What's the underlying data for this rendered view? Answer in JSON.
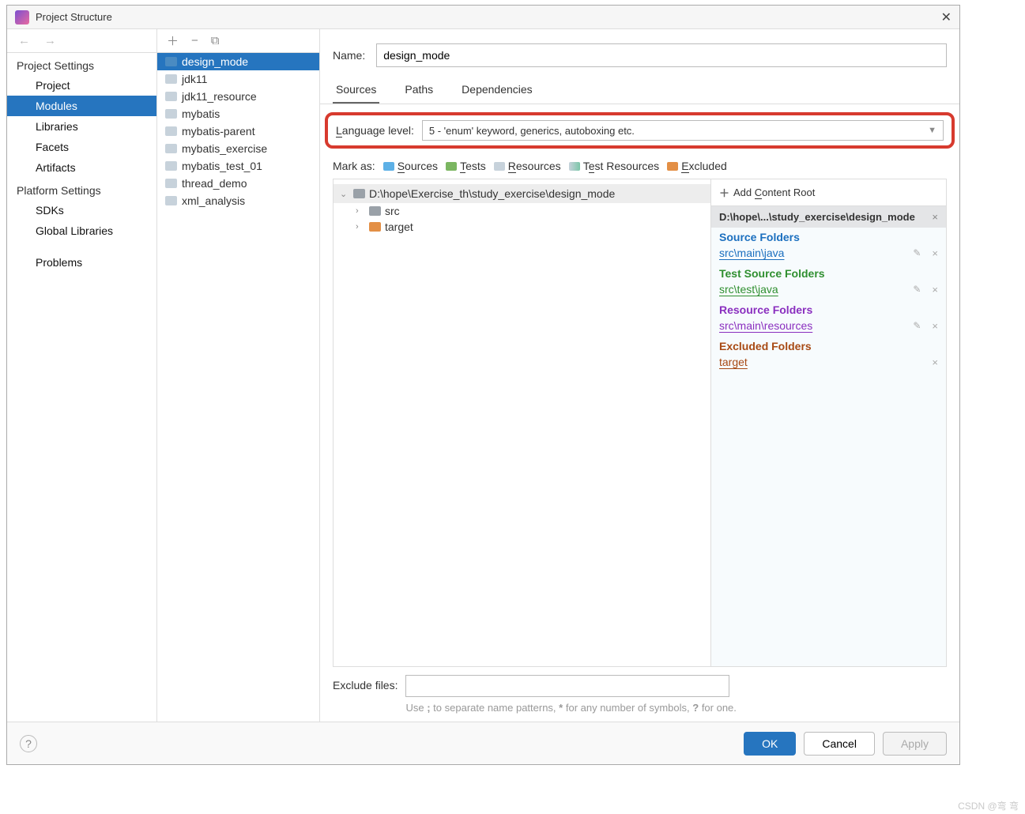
{
  "title": "Project Structure",
  "nav": {
    "project_settings": "Project Settings",
    "project": "Project",
    "modules": "Modules",
    "libraries": "Libraries",
    "facets": "Facets",
    "artifacts": "Artifacts",
    "platform_settings": "Platform Settings",
    "sdks": "SDKs",
    "global_libs": "Global Libraries",
    "problems": "Problems"
  },
  "modules": [
    "design_mode",
    "jdk11",
    "jdk11_resource",
    "mybatis",
    "mybatis-parent",
    "mybatis_exercise",
    "mybatis_test_01",
    "thread_demo",
    "xml_analysis"
  ],
  "name_label": "Name:",
  "name_value": "design_mode",
  "tabs": {
    "sources": "Sources",
    "paths": "Paths",
    "dependencies": "Dependencies"
  },
  "lang_label": "Language level:",
  "lang_value": "5 - 'enum' keyword, generics, autoboxing etc.",
  "mark_as": "Mark as:",
  "mark": {
    "sources": "Sources",
    "tests": "Tests",
    "resources": "Resources",
    "test_resources": "Test Resources",
    "excluded": "Excluded"
  },
  "tree": {
    "root": "D:\\hope\\Exercise_th\\study_exercise\\design_mode",
    "src": "src",
    "target": "target"
  },
  "cr": {
    "add": "Add Content Root",
    "path": "D:\\hope\\...\\study_exercise\\design_mode",
    "source_title": "Source Folders",
    "source_item": "src\\main\\java",
    "test_title": "Test Source Folders",
    "test_item": "src\\test\\java",
    "resource_title": "Resource Folders",
    "resource_item": "src\\main\\resources",
    "excluded_title": "Excluded Folders",
    "excluded_item": "target"
  },
  "exclude_label": "Exclude files:",
  "exclude_hint": "Use ; to separate name patterns, * for any number of symbols, ? for one.",
  "buttons": {
    "ok": "OK",
    "cancel": "Cancel",
    "apply": "Apply"
  },
  "watermark": "CSDN @弯 弯"
}
